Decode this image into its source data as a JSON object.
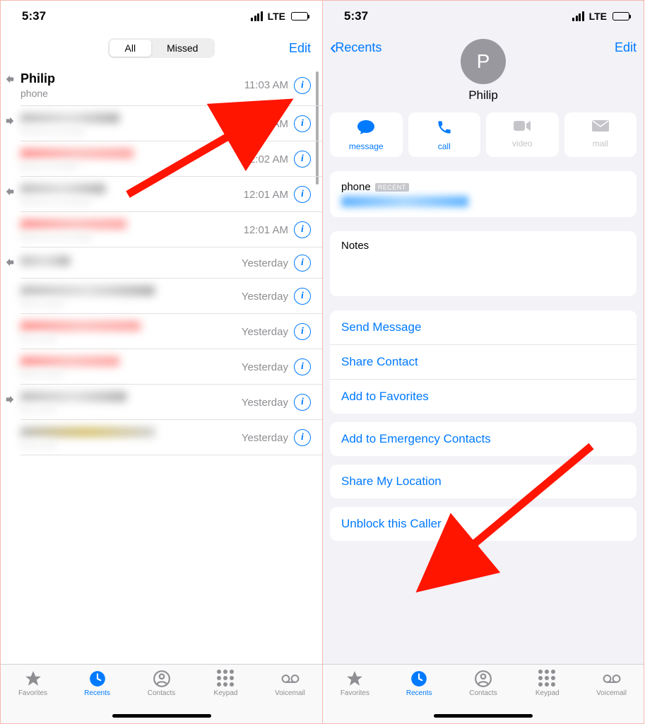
{
  "status": {
    "time": "5:37",
    "network": "LTE"
  },
  "left": {
    "seg_all": "All",
    "seg_missed": "Missed",
    "edit": "Edit",
    "calls": [
      {
        "name": "Philip",
        "sub": "phone",
        "time": "11:03 AM",
        "missed": false,
        "icon": "in"
      },
      {
        "name": "",
        "sub": "",
        "time": "12:02 AM",
        "missed": false,
        "icon": "out"
      },
      {
        "name": "",
        "sub": "",
        "time": "12:02 AM",
        "missed": true,
        "icon": ""
      },
      {
        "name": "",
        "sub": "",
        "time": "12:01 AM",
        "missed": false,
        "icon": "in"
      },
      {
        "name": "",
        "sub": "",
        "time": "12:01 AM",
        "missed": true,
        "icon": ""
      },
      {
        "name": "",
        "sub": "",
        "time": "Yesterday",
        "missed": false,
        "icon": "in"
      },
      {
        "name": "",
        "sub": "",
        "time": "Yesterday",
        "missed": false,
        "icon": ""
      },
      {
        "name": "",
        "sub": "",
        "time": "Yesterday",
        "missed": true,
        "icon": ""
      },
      {
        "name": "",
        "sub": "",
        "time": "Yesterday",
        "missed": true,
        "icon": ""
      },
      {
        "name": "",
        "sub": "",
        "time": "Yesterday",
        "missed": false,
        "icon": "out"
      },
      {
        "name": "",
        "sub": "",
        "time": "Yesterday",
        "missed": false,
        "icon": ""
      }
    ],
    "tabs": {
      "fav": "Favorites",
      "rec": "Recents",
      "con": "Contacts",
      "key": "Keypad",
      "vm": "Voicemail"
    }
  },
  "right": {
    "back": "Recents",
    "edit": "Edit",
    "avatar_initial": "P",
    "name": "Philip",
    "actions": {
      "msg": "message",
      "call": "call",
      "video": "video",
      "mail": "mail"
    },
    "phone_label": "phone",
    "recent_tag": "RECENT",
    "notes_label": "Notes",
    "links": {
      "send": "Send Message",
      "share": "Share Contact",
      "fav": "Add to Favorites",
      "emerg": "Add to Emergency Contacts",
      "loc": "Share My Location",
      "unblock": "Unblock this Caller"
    }
  }
}
